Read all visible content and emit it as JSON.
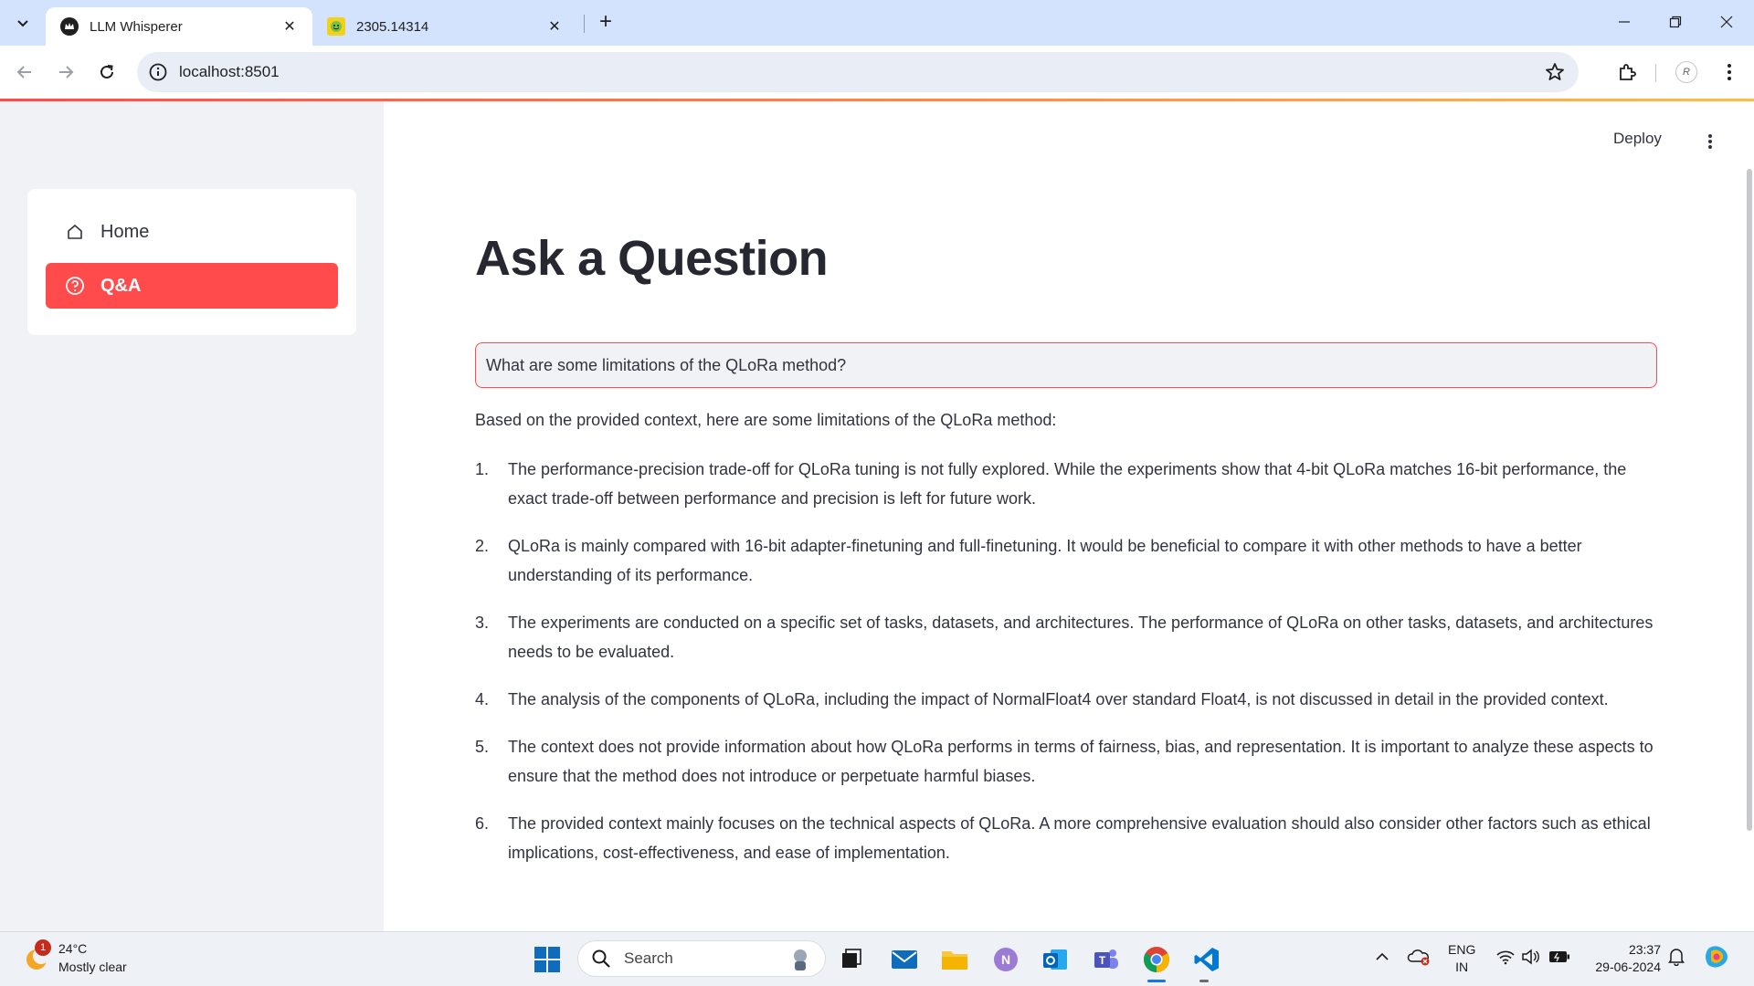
{
  "browser": {
    "tabs": [
      {
        "title": "LLM Whisperer",
        "active": true
      },
      {
        "title": "2305.14314",
        "active": false
      }
    ],
    "url": "localhost:8501",
    "profile_initial": "R"
  },
  "app": {
    "header": {
      "deploy_label": "Deploy"
    },
    "sidebar": {
      "items": [
        {
          "label": "Home",
          "icon": "house-icon",
          "selected": false
        },
        {
          "label": "Q&A",
          "icon": "question-circle-icon",
          "selected": true
        }
      ]
    },
    "main": {
      "title": "Ask a Question",
      "question_value": "What are some limitations of the QLoRa method?",
      "answer_intro": "Based on the provided context, here are some limitations of the QLoRa method:",
      "answer_items": [
        {
          "num": "1.",
          "text": "The performance-precision trade-off for QLoRa tuning is not fully explored. While the experiments show that 4-bit QLoRa matches 16-bit performance, the exact trade-off between performance and precision is left for future work."
        },
        {
          "num": "2.",
          "text": "QLoRa is mainly compared with 16-bit adapter-finetuning and full-finetuning. It would be beneficial to compare it with other methods to have a better understanding of its performance."
        },
        {
          "num": "3.",
          "text": "The experiments are conducted on a specific set of tasks, datasets, and architectures. The performance of QLoRa on other tasks, datasets, and architectures needs to be evaluated."
        },
        {
          "num": "4.",
          "text": "The analysis of the components of QLoRa, including the impact of NormalFloat4 over standard Float4, is not discussed in detail in the provided context."
        },
        {
          "num": "5.",
          "text": "The context does not provide information about how QLoRa performs in terms of fairness, bias, and representation. It is important to analyze these aspects to ensure that the method does not introduce or perpetuate harmful biases."
        },
        {
          "num": "6.",
          "text": "The provided context mainly focuses on the technical aspects of QLoRa. A more comprehensive evaluation should also consider other factors such as ethical implications, cost-effectiveness, and ease of implementation."
        }
      ]
    }
  },
  "taskbar": {
    "weather": {
      "temp": "24°C",
      "desc": "Mostly clear",
      "badge": "1"
    },
    "search_label": "Search",
    "lang_line1": "ENG",
    "lang_line2": "IN",
    "time": "23:37",
    "date": "29-06-2024"
  },
  "colors": {
    "accent": "#ff4b4b",
    "sidebar_bg": "#f0f2f6",
    "tab_bar": "#d3e3fd"
  }
}
